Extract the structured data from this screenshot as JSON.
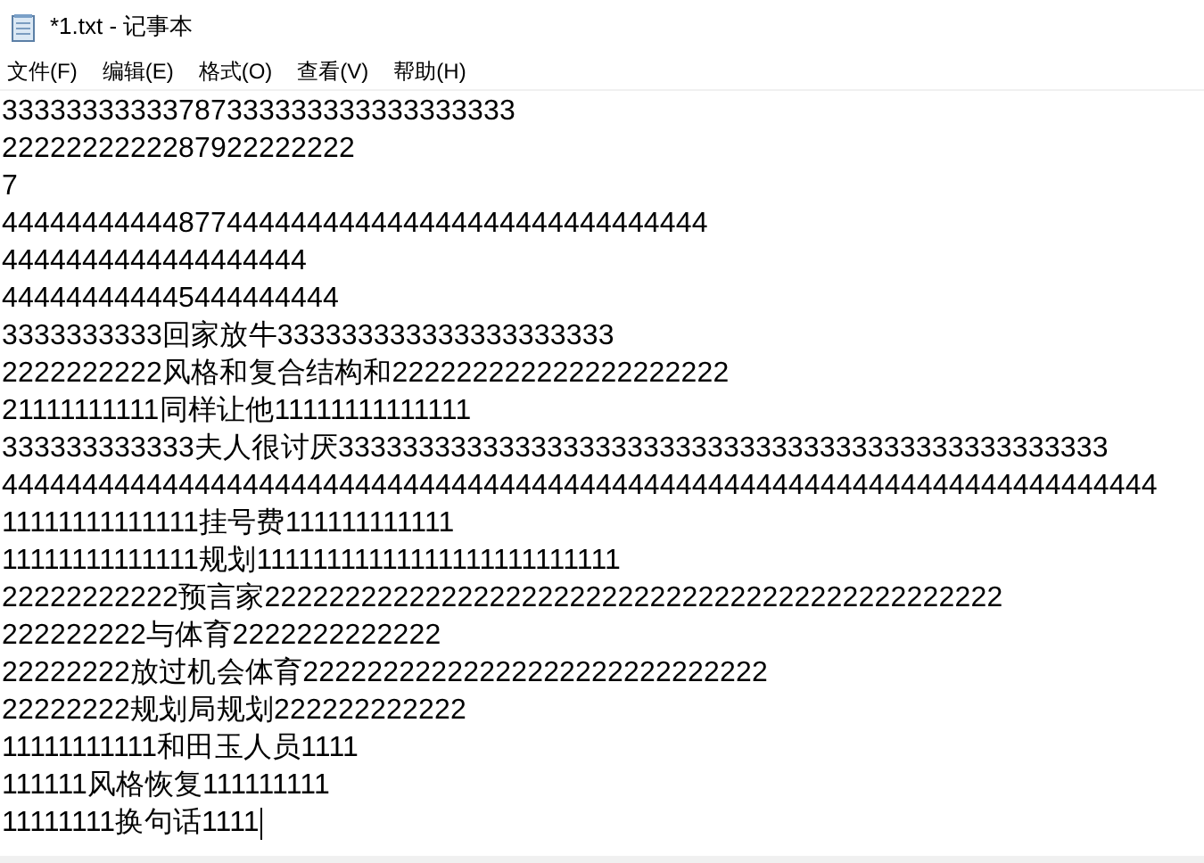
{
  "window": {
    "title": "*1.txt - 记事本"
  },
  "menu": [
    "文件(F)",
    "编辑(E)",
    "格式(O)",
    "查看(V)",
    "帮助(H)"
  ],
  "lines": [
    {
      "text": "33333333333787333333333333333333",
      "cursor": false
    },
    {
      "text": "2222222222287922222222",
      "cursor": false
    },
    {
      "text": "7",
      "cursor": false
    },
    {
      "text": "44444444444877444444444444444444444444444444",
      "cursor": false
    },
    {
      "text": "4444444444444444444",
      "cursor": false
    },
    {
      "text": "444444444445444444444",
      "cursor": false
    },
    {
      "text": "3333333333回家放牛333333333333333333333",
      "cursor": false
    },
    {
      "text": "2222222222风格和复合结构和222222222222222222222",
      "cursor": false
    },
    {
      "text": "21111111111同样让他11111111111111",
      "cursor": false
    },
    {
      "text": "333333333333夫人很讨厌333333333333333333333333333333333333333333333333",
      "cursor": false
    },
    {
      "text": "444444444444444444444444444444444444444444444444444444444444444444444444",
      "cursor": false
    },
    {
      "text": "11111111111111挂号费111111111111",
      "cursor": false
    },
    {
      "text": "11111111111111规划11111111111111111111111111",
      "cursor": false
    },
    {
      "text": "22222222222预言家2222222222222222222222222222222222222222222222",
      "cursor": false
    },
    {
      "text": "222222222与体育2222222222222",
      "cursor": false
    },
    {
      "text": "22222222放过机会体育22222222222222222222222222222",
      "cursor": false
    },
    {
      "text": "22222222规划局规划222222222222",
      "cursor": false
    },
    {
      "text": "11111111111和田玉人员1111",
      "cursor": false
    },
    {
      "text": "111111风格恢复111111111",
      "cursor": false
    },
    {
      "text": "11111111换句话1111",
      "cursor": true
    }
  ]
}
